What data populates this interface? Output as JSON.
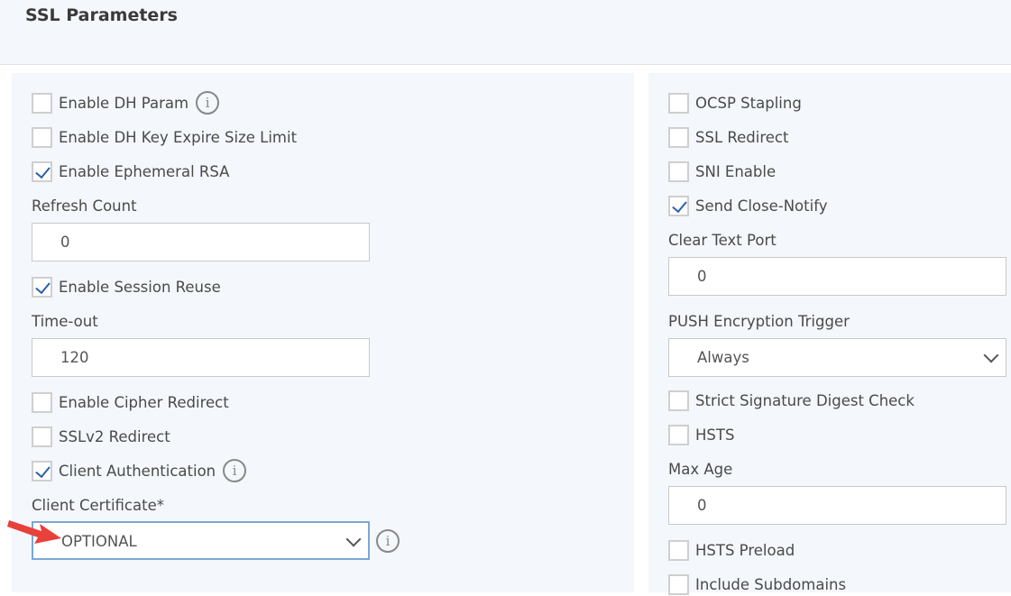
{
  "header": {
    "title": "SSL Parameters"
  },
  "left": {
    "enable_dh_param": {
      "label": "Enable DH Param",
      "checked": false
    },
    "enable_dh_key_expire": {
      "label": "Enable DH Key Expire Size Limit",
      "checked": false
    },
    "enable_ephemeral_rsa": {
      "label": "Enable Ephemeral RSA",
      "checked": true
    },
    "refresh_count": {
      "label": "Refresh Count",
      "value": "0"
    },
    "enable_session_reuse": {
      "label": "Enable Session Reuse",
      "checked": true
    },
    "timeout": {
      "label": "Time-out",
      "value": "120"
    },
    "enable_cipher_redirect": {
      "label": "Enable Cipher Redirect",
      "checked": false
    },
    "sslv2_redirect": {
      "label": "SSLv2 Redirect",
      "checked": false
    },
    "client_authentication": {
      "label": "Client Authentication",
      "checked": true
    },
    "client_certificate": {
      "label": "Client Certificate*",
      "value": "OPTIONAL"
    }
  },
  "right": {
    "ocsp_stapling": {
      "label": "OCSP Stapling",
      "checked": false
    },
    "ssl_redirect": {
      "label": "SSL Redirect",
      "checked": false
    },
    "sni_enable": {
      "label": "SNI Enable",
      "checked": false
    },
    "send_close_notify": {
      "label": "Send Close-Notify",
      "checked": true
    },
    "clear_text_port": {
      "label": "Clear Text Port",
      "value": "0"
    },
    "push_encryption_trigger": {
      "label": "PUSH Encryption Trigger",
      "value": "Always"
    },
    "strict_sig_digest": {
      "label": "Strict Signature Digest Check",
      "checked": false
    },
    "hsts": {
      "label": "HSTS",
      "checked": false
    },
    "max_age": {
      "label": "Max Age",
      "value": "0"
    },
    "hsts_preload": {
      "label": "HSTS Preload",
      "checked": false
    },
    "include_subdomains": {
      "label": "Include Subdomains",
      "checked": false
    }
  },
  "icons": {
    "info": "info-circle-icon",
    "arrow": "red-pointer-arrow"
  },
  "colors": {
    "arrow": "#e8403a",
    "focus_border": "#7aa7d6",
    "check": "#2a5ea8"
  }
}
